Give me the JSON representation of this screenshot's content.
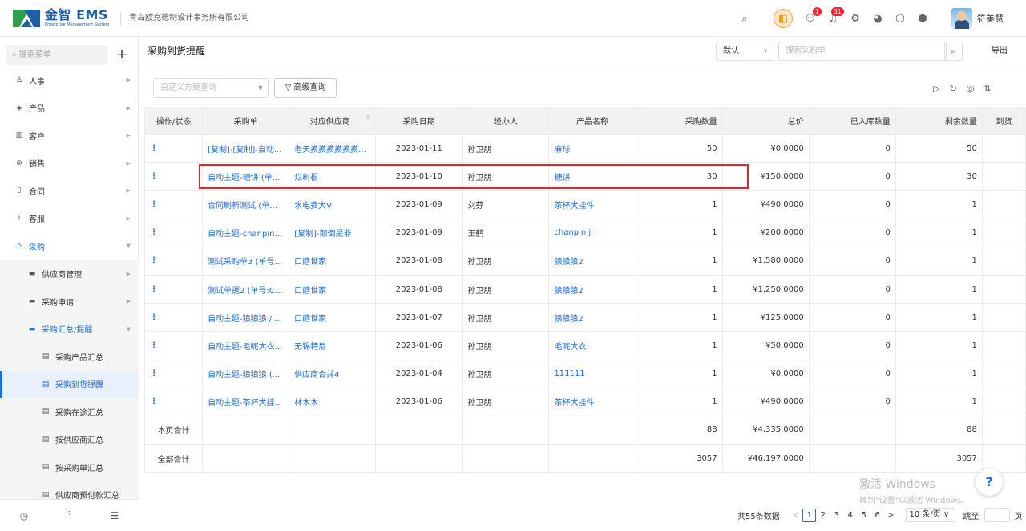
{
  "header": {
    "logo_title": "金智 EMS",
    "logo_sub": "Enterprise Management System",
    "company": "青岛欧克德制设计事务所有限公司",
    "badges": {
      "people": "1",
      "bell": "31"
    },
    "user_name": "符美慧"
  },
  "sidebar": {
    "search_placeholder": "搜索菜单",
    "plus": "+",
    "items": [
      {
        "label": "人事",
        "icon": "person-icon"
      },
      {
        "label": "产品",
        "icon": "product-icon"
      },
      {
        "label": "客户",
        "icon": "customer-icon"
      },
      {
        "label": "销售",
        "icon": "sales-icon"
      },
      {
        "label": "合同",
        "icon": "contract-icon"
      },
      {
        "label": "客服",
        "icon": "service-icon"
      },
      {
        "label": "采购",
        "icon": "purchase-icon"
      },
      {
        "label": "供应商管理",
        "icon": "folder-icon"
      },
      {
        "label": "采购申请",
        "icon": "folder-icon"
      },
      {
        "label": "采购汇总/提醒",
        "icon": "folder-icon"
      },
      {
        "label": "采购产品汇总",
        "icon": "report-icon"
      },
      {
        "label": "采购到货提醒",
        "icon": "report-icon"
      },
      {
        "label": "采购在途汇总",
        "icon": "report-icon"
      },
      {
        "label": "按供应商汇总",
        "icon": "report-icon"
      },
      {
        "label": "按采购单汇总",
        "icon": "report-icon"
      },
      {
        "label": "供应商预付款汇总",
        "icon": "report-icon"
      }
    ]
  },
  "page": {
    "title": "采购到货提醒",
    "default_view": "默认",
    "search_placeholder": "搜索采购单",
    "export_label": "导出",
    "filter_placeholder": "自定义方案查询",
    "advanced_query": "高级查询"
  },
  "table": {
    "columns": [
      "操作/状态",
      "采购单",
      "对应供应商",
      "采购日期",
      "经办人",
      "产品名称",
      "采购数量",
      "总价",
      "已入库数量",
      "剩余数量",
      "到货"
    ],
    "rows": [
      {
        "action": "⋮",
        "order": "[复制]-[复制]-自动...",
        "supplier": "老天摸摸摸摸摸摸...",
        "date": "2023-01-11",
        "handler": "孙卫朋",
        "product": "麻球",
        "qty": "50",
        "total": "¥0.0000",
        "received": "0",
        "remaining": "50"
      },
      {
        "action": "⋮",
        "order": "自动主题-糖饼 (单...",
        "supplier": "烂树根",
        "date": "2023-01-10",
        "handler": "孙卫朋",
        "product": "糖饼",
        "qty": "30",
        "total": "¥150.0000",
        "received": "0",
        "remaining": "30"
      },
      {
        "action": "⋮",
        "order": "合同刷新测试 (单号...",
        "supplier": "水电费大V",
        "date": "2023-01-09",
        "handler": "刘芬",
        "product": "茶杯犬挂件",
        "qty": "1",
        "total": "¥490.0000",
        "received": "0",
        "remaining": "1"
      },
      {
        "action": "⋮",
        "order": "自动主题-chanpin ji...",
        "supplier": "[复制]-颠倒是非",
        "date": "2023-01-09",
        "handler": "王鹤",
        "product": "chanpin ji",
        "qty": "1",
        "total": "¥200.0000",
        "received": "0",
        "remaining": "1"
      },
      {
        "action": "⋮",
        "order": "测试采购单3 (单号:...",
        "supplier": "口蘑世家",
        "date": "2023-01-08",
        "handler": "孙卫朋",
        "product": "狼狼狼2",
        "qty": "1",
        "total": "¥1,580.0000",
        "received": "0",
        "remaining": "1"
      },
      {
        "action": "⋮",
        "order": "测试单据2 (单号:CG...",
        "supplier": "口蘑世家",
        "date": "2023-01-08",
        "handler": "孙卫朋",
        "product": "狼狼狼2",
        "qty": "1",
        "total": "¥1,250.0000",
        "received": "0",
        "remaining": "1"
      },
      {
        "action": "⋮",
        "order": "自动主题-狼狼狼 / ...",
        "supplier": "口蘑世家",
        "date": "2023-01-07",
        "handler": "孙卫朋",
        "product": "狼狼狼2",
        "qty": "1",
        "total": "¥125.0000",
        "received": "0",
        "remaining": "1"
      },
      {
        "action": "⋮",
        "order": "自动主题-毛呢大衣 ...",
        "supplier": "无锡特尼",
        "date": "2023-01-06",
        "handler": "孙卫朋",
        "product": "毛呢大衣",
        "qty": "1",
        "total": "¥50.0000",
        "received": "0",
        "remaining": "1"
      },
      {
        "action": "⋮",
        "order": "自动主题-狼狼狼 (...",
        "supplier": "供应商合并4",
        "date": "2023-01-04",
        "handler": "孙卫朋",
        "product": "111111",
        "qty": "1",
        "total": "¥0.0000",
        "received": "0",
        "remaining": "1"
      },
      {
        "action": "⋮",
        "order": "自动主题-茶杯犬挂...",
        "supplier": "林木木",
        "date": "2023-01-06",
        "handler": "孙卫朋",
        "product": "茶杯犬挂件",
        "qty": "1",
        "total": "¥490.0000",
        "received": "0",
        "remaining": "1"
      }
    ],
    "page_total": {
      "label": "本页合计",
      "qty": "88",
      "total": "¥4,335.0000",
      "remaining": "88"
    },
    "all_total": {
      "label": "全部合计",
      "qty": "3057",
      "total": "¥46,197.0000",
      "remaining": "3057"
    }
  },
  "pagination": {
    "total": "共55条数据",
    "prev": "<",
    "pages": [
      "1",
      "2",
      "3",
      "4",
      "5",
      "6"
    ],
    "current": "1",
    "next": ">",
    "page_size": "10 条/页",
    "jump_label": "跳至",
    "page_unit": "页"
  },
  "watermark": {
    "line1": "激活 Windows",
    "line2": "转到\"设置\"以激活 Windows。"
  }
}
